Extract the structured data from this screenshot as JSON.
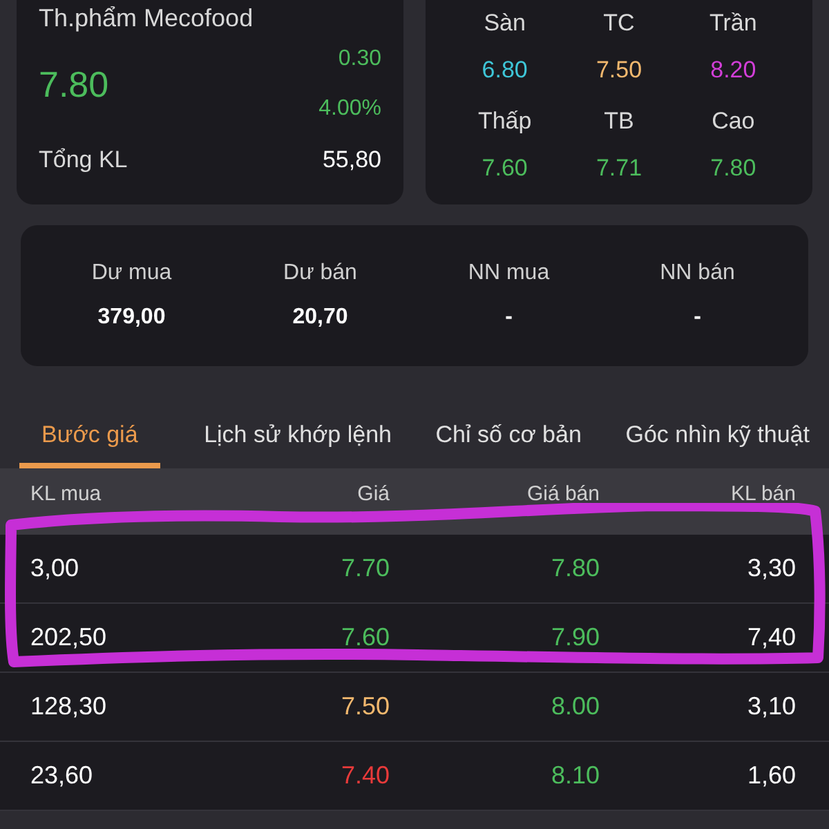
{
  "quote": {
    "name": "Th.phẩm Mecofood",
    "price": "7.80",
    "change": "0.30",
    "change_percent": "4.00%",
    "volume_label": "Tổng KL",
    "volume": "55,80"
  },
  "price_levels": [
    {
      "label": "Sàn",
      "value": "6.80",
      "color": "#3ec6d8"
    },
    {
      "label": "TC",
      "value": "7.50",
      "color": "#f2b86e"
    },
    {
      "label": "Trần",
      "value": "8.20",
      "color": "#d23ed8"
    },
    {
      "label": "Thấp",
      "value": "7.60",
      "color": "#4cbc5c"
    },
    {
      "label": "TB",
      "value": "7.71",
      "color": "#4cbc5c"
    },
    {
      "label": "Cao",
      "value": "7.80",
      "color": "#4cbc5c"
    }
  ],
  "summary": [
    {
      "label": "Dư mua",
      "value": "379,00"
    },
    {
      "label": "Dư bán",
      "value": "20,70"
    },
    {
      "label": "NN mua",
      "value": "-"
    },
    {
      "label": "NN bán",
      "value": "-"
    }
  ],
  "tabs": [
    {
      "label": "Bước giá",
      "selected": true
    },
    {
      "label": "Lịch sử khớp lệnh",
      "selected": false
    },
    {
      "label": "Chỉ số cơ bản",
      "selected": false
    },
    {
      "label": "Góc nhìn kỹ thuật",
      "selected": false
    }
  ],
  "table": {
    "columns": [
      "KL mua",
      "Giá",
      "Giá bán",
      "KL bán"
    ],
    "rows": [
      {
        "buy_volume": "3,00",
        "buy_price": {
          "text": "7.70",
          "color": "#4cbc5c"
        },
        "sell_price": {
          "text": "7.80",
          "color": "#4cbc5c"
        },
        "sell_volume": "3,30"
      },
      {
        "buy_volume": "202,50",
        "buy_price": {
          "text": "7.60",
          "color": "#4cbc5c"
        },
        "sell_price": {
          "text": "7.90",
          "color": "#4cbc5c"
        },
        "sell_volume": "7,40"
      },
      {
        "buy_volume": "128,30",
        "buy_price": {
          "text": "7.50",
          "color": "#f2b86e"
        },
        "sell_price": {
          "text": "8.00",
          "color": "#4cbc5c"
        },
        "sell_volume": "3,10"
      },
      {
        "buy_volume": "23,60",
        "buy_price": {
          "text": "7.40",
          "color": "#e83a3a"
        },
        "sell_price": {
          "text": "8.10",
          "color": "#4cbc5c"
        },
        "sell_volume": "1,60"
      }
    ]
  }
}
